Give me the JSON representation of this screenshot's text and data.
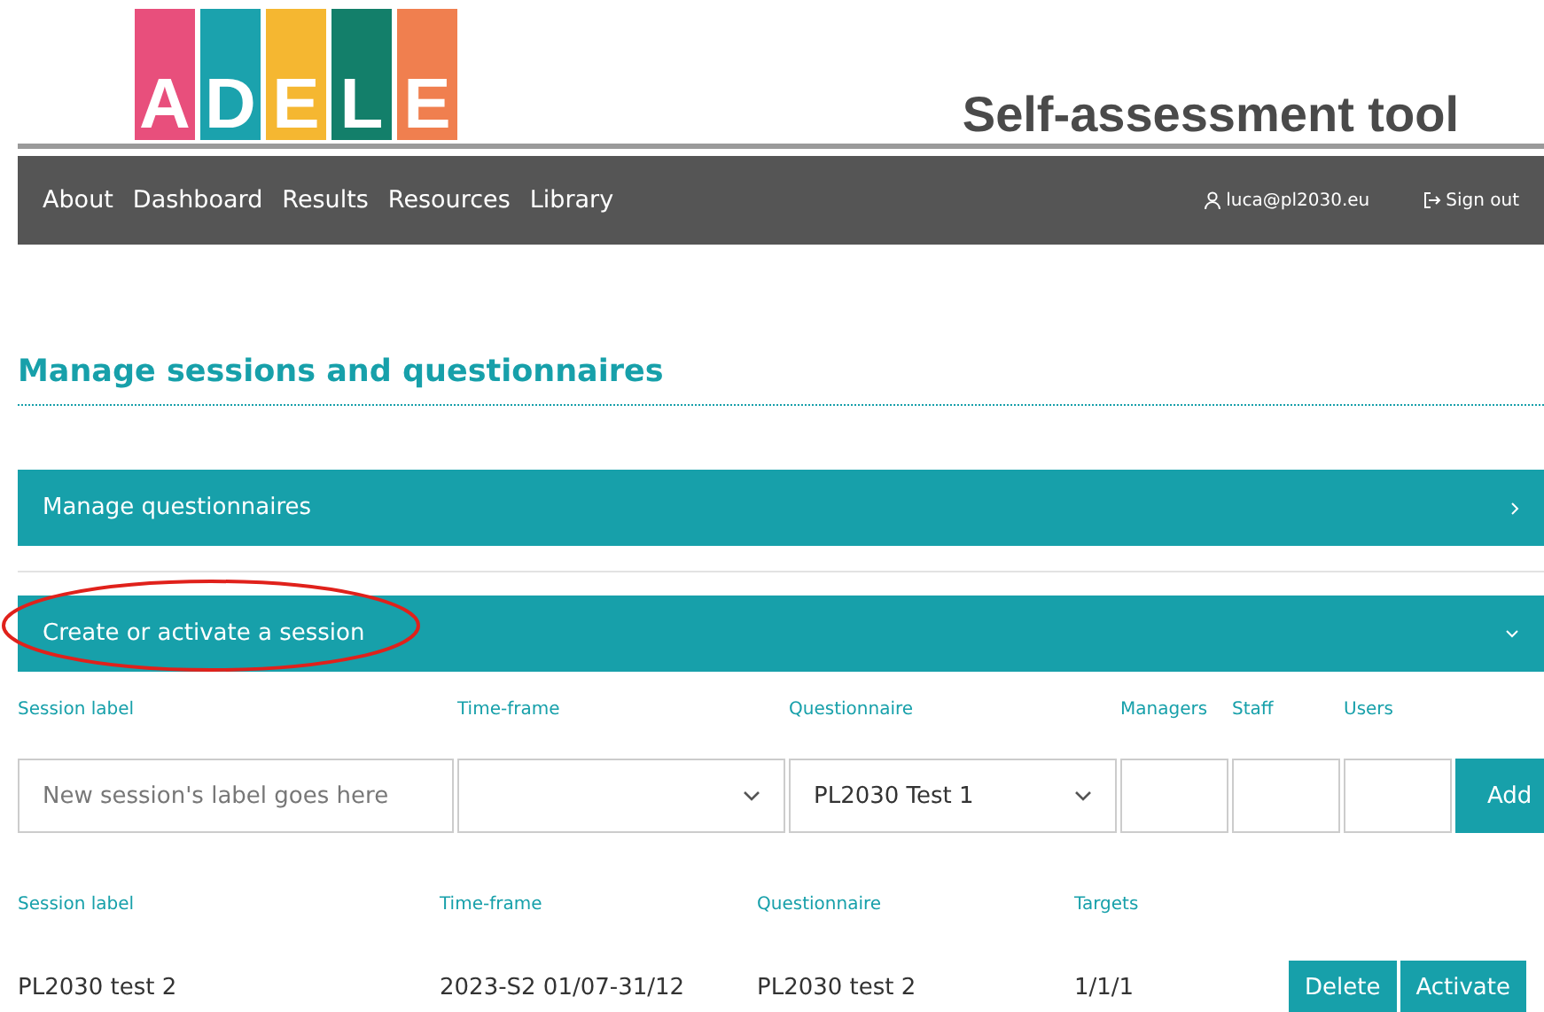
{
  "logo": {
    "letters": [
      {
        "char": "A",
        "color": "#e84f7c"
      },
      {
        "char": "D",
        "color": "#1ba2ad"
      },
      {
        "char": "E",
        "color": "#f5b731"
      },
      {
        "char": "L",
        "color": "#137f6a"
      },
      {
        "char": "E",
        "color": "#f07f4f"
      }
    ]
  },
  "app_title": "Self-assessment tool",
  "nav": {
    "items": [
      "About",
      "Dashboard",
      "Results",
      "Resources",
      "Library"
    ],
    "user": "luca@pl2030.eu",
    "sign_out": "Sign out"
  },
  "heading": "Manage sessions and questionnaires",
  "sections": [
    {
      "title": "Manage questionnaires",
      "expanded": false,
      "highlighted": false
    },
    {
      "title": "Create or activate a session",
      "expanded": true,
      "highlighted": true
    }
  ],
  "form": {
    "labels": [
      "Session label",
      "Time-frame",
      "Questionnaire",
      "Managers",
      "Staff",
      "Users"
    ],
    "fields": [
      {
        "kind": "text",
        "placeholder": "New session's label goes here"
      },
      {
        "kind": "select"
      },
      {
        "kind": "select",
        "value": "PL2030 Test 1"
      },
      {
        "kind": "text"
      },
      {
        "kind": "text"
      },
      {
        "kind": "text"
      }
    ],
    "add_button": "Add"
  },
  "table": {
    "columns": [
      "Session label",
      "Time-frame",
      "Questionnaire",
      "Targets"
    ],
    "rows": [
      {
        "cells": [
          "PL2030 test 2",
          "2023-S2 01/07-31/12",
          "PL2030 test 2",
          "1/1/1"
        ],
        "actions": [
          "Delete",
          "Activate"
        ]
      }
    ]
  }
}
